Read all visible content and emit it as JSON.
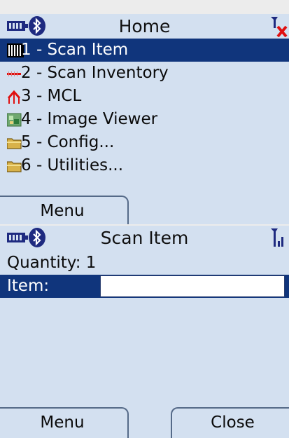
{
  "home": {
    "title": "Home",
    "menu_items": [
      {
        "label": "1 - Scan Item",
        "icon": "barcode-icon",
        "selected": true
      },
      {
        "label": "2 - Scan Inventory",
        "icon": "scanner-beam-icon",
        "selected": false
      },
      {
        "label": "3 - MCL",
        "icon": "mcl-icon",
        "selected": false
      },
      {
        "label": "4 - Image Viewer",
        "icon": "image-icon",
        "selected": false
      },
      {
        "label": "5 - Config...",
        "icon": "folder-icon",
        "selected": false
      },
      {
        "label": "6 - Utilities...",
        "icon": "folder-icon",
        "selected": false
      }
    ],
    "softkey_menu": "Menu"
  },
  "scan_item": {
    "title": "Scan Item",
    "quantity_text": "Quantity: 1",
    "item_label": "Item:",
    "item_value": "",
    "softkey_menu": "Menu",
    "softkey_close": "Close"
  },
  "colors": {
    "background": "#d3e0f0",
    "selection": "#10357c",
    "alert_red": "#e01010"
  },
  "status_icons": [
    "battery-icon",
    "bluetooth-icon",
    "antenna-no-signal-icon",
    "antenna-signal-icon"
  ]
}
